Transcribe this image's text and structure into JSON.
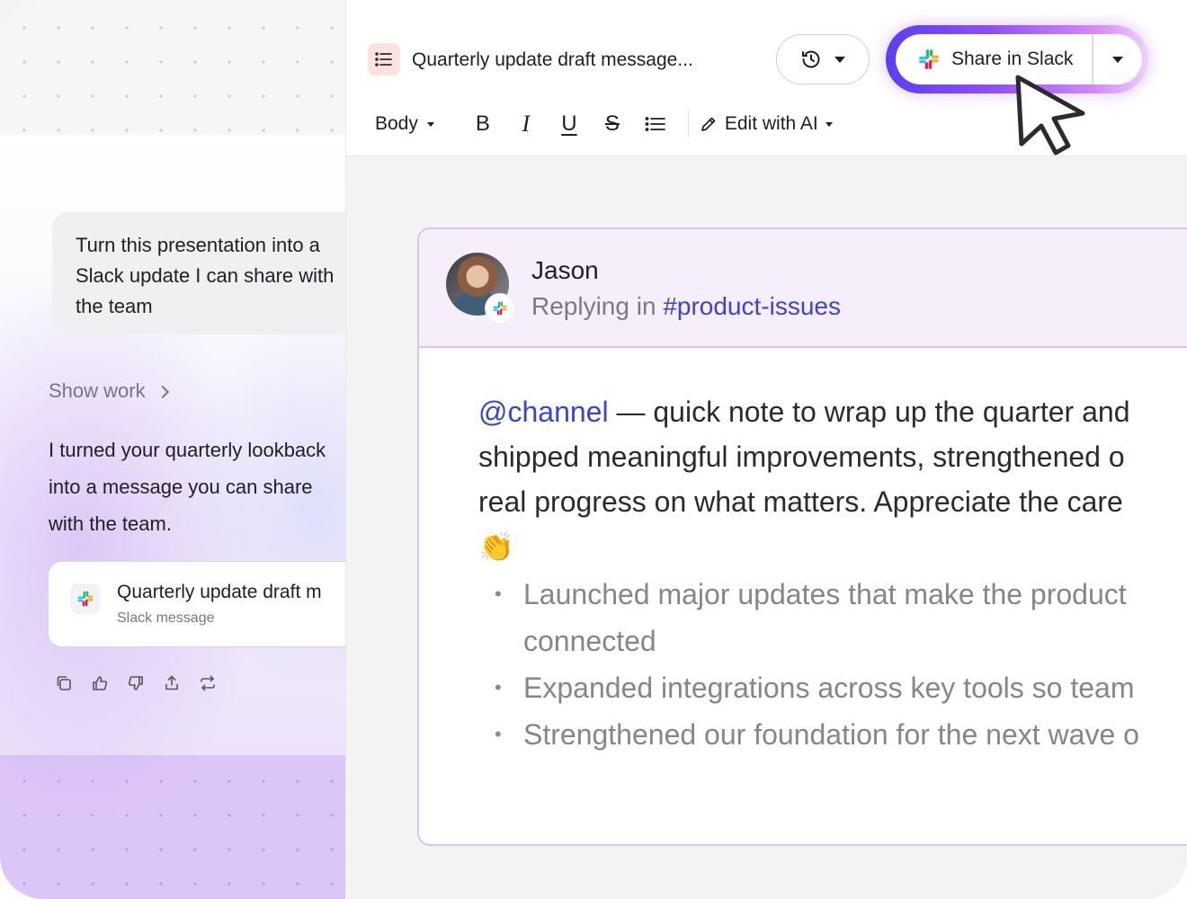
{
  "left_panel": {
    "user_message": "Turn this presentation into a Slack update I can share with the team",
    "show_work_label": "Show work",
    "assistant_reply": "I turned your quarterly lookback into a message you can share with the team.",
    "attachment": {
      "title": "Quarterly update draft m",
      "subtitle": "Slack message",
      "icon": "slack-icon"
    },
    "actions": [
      "copy-icon",
      "thumbs-up-icon",
      "thumbs-down-icon",
      "share-icon",
      "regenerate-icon"
    ]
  },
  "editor": {
    "doc_title": "Quarterly update draft message...",
    "share_button_label": "Share in Slack",
    "format": {
      "style_label": "Body",
      "bold": "B",
      "italic": "I",
      "underline": "U",
      "strike": "S",
      "edit_ai_label": "Edit with AI"
    },
    "colors": {
      "accent": "#3a44d4",
      "share_glow_start": "#5b3df5",
      "share_glow_end": "#d58af7",
      "card_border": "#dbc2ef"
    }
  },
  "message": {
    "sender": "Jason",
    "replying_prefix": "Replying in ",
    "channel": "#product-issues",
    "mention": "@channel",
    "line1_rest": " — quick note to wrap up the quarter and",
    "line2": "shipped meaningful improvements, strengthened o",
    "line3": "real progress on what matters. Appreciate the care",
    "emoji": "👏",
    "bullets": [
      "Launched major updates that make the product",
      "connected",
      "Expanded integrations across key tools so team",
      "Strengthened our foundation for the next wave o"
    ]
  }
}
